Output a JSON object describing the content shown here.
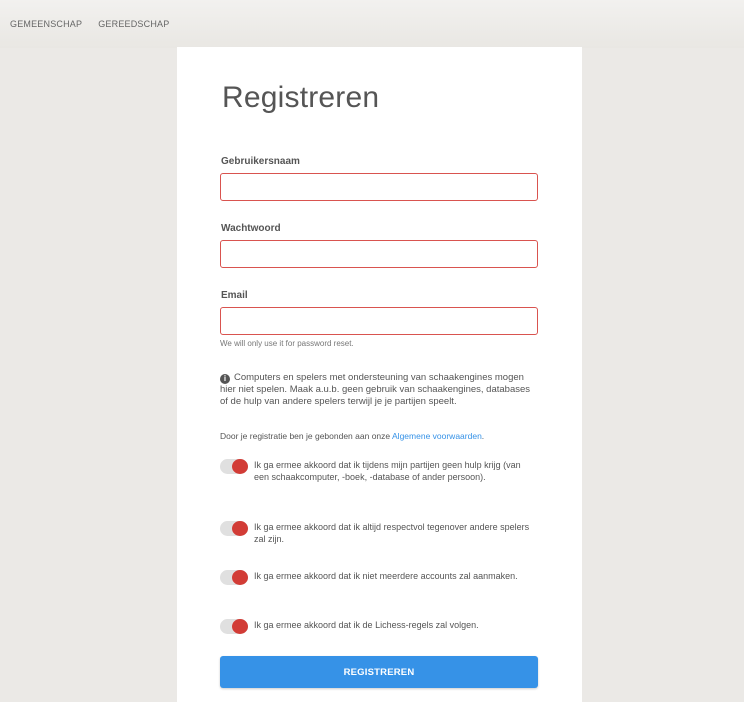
{
  "nav": [
    "GEMEENSCHAP",
    "GEREEDSCHAP"
  ],
  "form": {
    "title": "Registreren",
    "username_label": "Gebruikersnaam",
    "username_value": "",
    "password_label": "Wachtwoord",
    "password_value": "",
    "email_label": "Email",
    "email_value": "",
    "email_hint": "We will only use it for password reset.",
    "info_text": "Computers en spelers met ondersteuning van schaakengines mogen hier niet spelen. Maak a.u.b. geen gebruik van schaakengines, databases of de hulp van andere spelers terwijl je je partijen speelt.",
    "terms_prefix": "Door je registratie ben je gebonden aan onze ",
    "terms_link": "Algemene voorwaarden",
    "terms_suffix": ".",
    "agreements": [
      "Ik ga ermee akkoord dat ik tijdens mijn partijen geen hulp krijg (van een schaakcomputer, -boek, -database of ander persoon).",
      "Ik ga ermee akkoord dat ik altijd respectvol tegenover andere spelers zal zijn.",
      "Ik ga ermee akkoord dat ik niet meerdere accounts zal aanmaken.",
      "Ik ga ermee akkoord dat ik de Lichess-regels zal volgen."
    ],
    "submit_label": "REGISTREREN"
  },
  "colors": {
    "accent": "#3692e7",
    "error_border": "#d9534f",
    "toggle_off_knob": "#d23c36"
  },
  "icons": [
    "info-icon"
  ]
}
